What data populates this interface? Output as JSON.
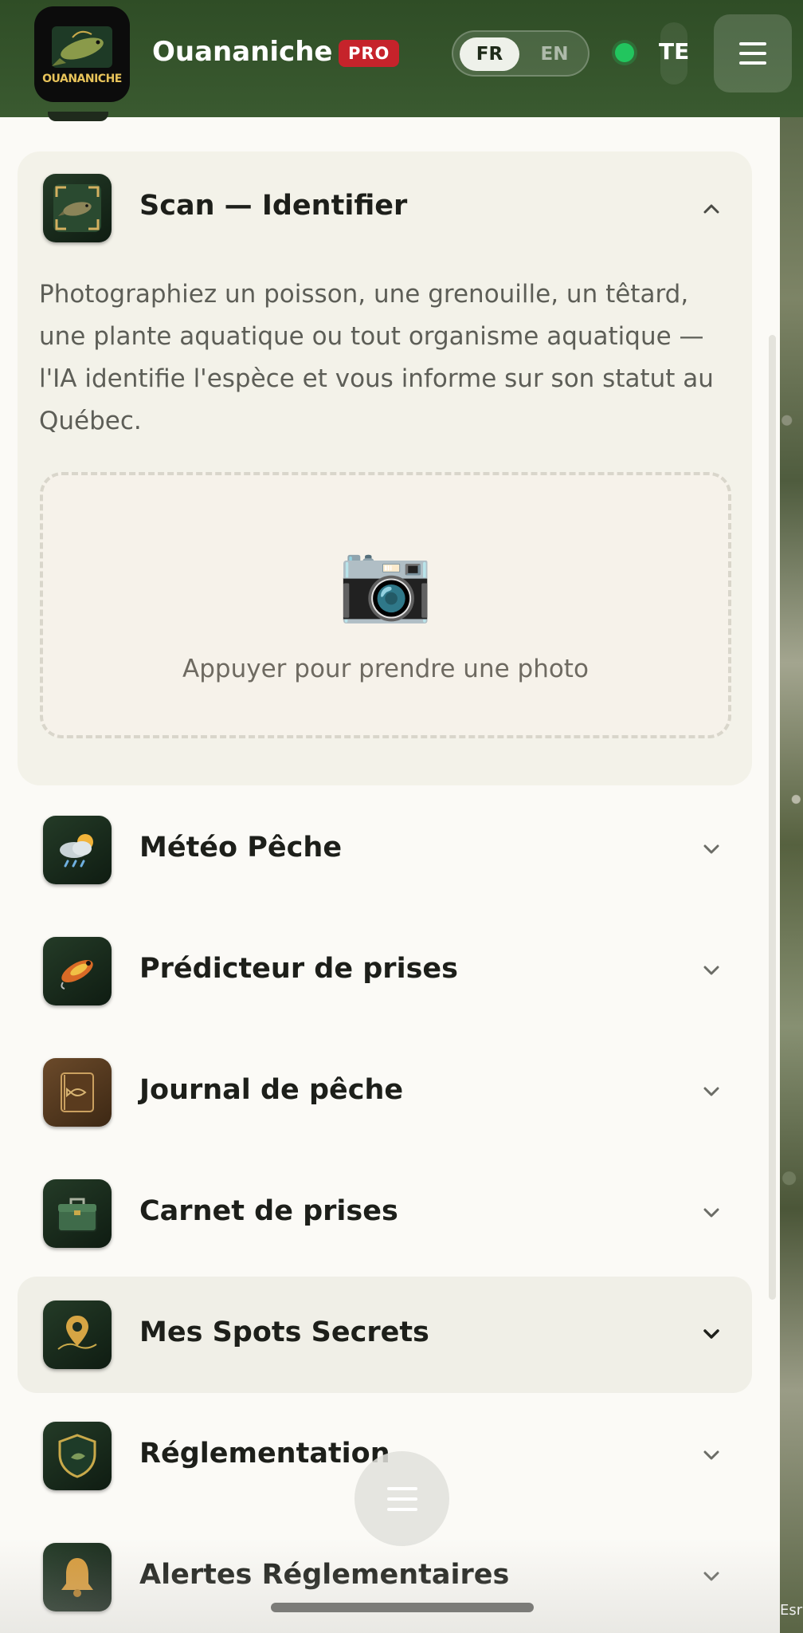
{
  "header": {
    "app_title": "Ouananiche",
    "logo_text": "OUANANICHE",
    "pro_badge": "PRO",
    "lang_options": [
      "FR",
      "EN"
    ],
    "lang_selected": "FR",
    "status_color": "#22c55e",
    "user_abbr": "TE",
    "menu_icon": "hamburger-icon"
  },
  "scan": {
    "title": "Scan — Identifier",
    "description": "Photographiez un poisson, une grenouille, un têtard, une plante aquatique ou tout organisme aquatique — l'IA identifie l'espèce et vous informe sur son statut au Québec.",
    "camera_glyph": "📷",
    "dropzone_label": "Appuyer pour prendre une photo",
    "expanded": true
  },
  "menu": {
    "items": [
      {
        "label": "Météo Pêche",
        "icon": "weather-icon"
      },
      {
        "label": "Prédicteur de prises",
        "icon": "lure-icon"
      },
      {
        "label": "Journal de pêche",
        "icon": "journal-icon"
      },
      {
        "label": "Carnet de prises",
        "icon": "tackle-box-icon"
      },
      {
        "label": "Mes Spots Secrets",
        "icon": "map-pin-icon"
      },
      {
        "label": "Réglementation",
        "icon": "shield-icon"
      },
      {
        "label": "Alertes Réglementaires",
        "icon": "bell-icon"
      }
    ]
  },
  "map": {
    "attribution": "Esri"
  },
  "colors": {
    "header_bg": "#2f4d26",
    "pro_badge": "#c6232b",
    "status_online": "#22c55e",
    "card_bg": "#f3f2e9"
  }
}
